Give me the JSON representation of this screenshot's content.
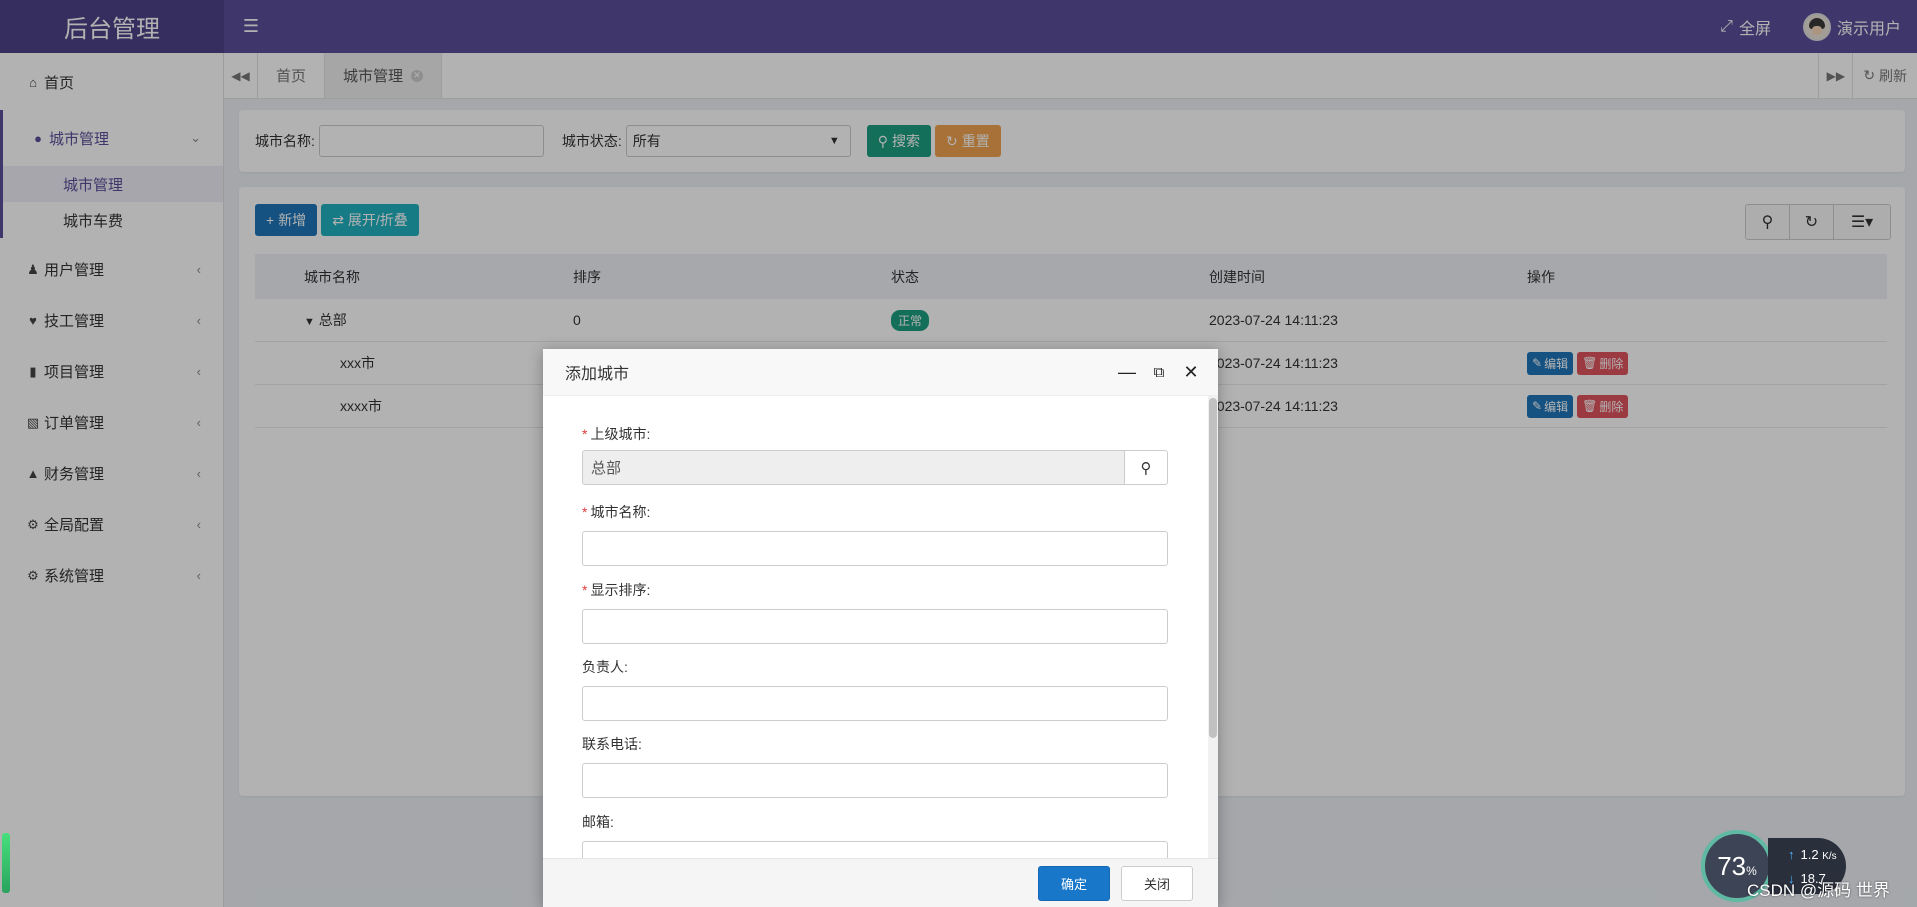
{
  "header": {
    "logo": "后台管理",
    "fullscreen_label": "全屏",
    "user_label": "演示用户"
  },
  "sidebar": {
    "items": [
      {
        "label": "首页",
        "icon": "home-icon"
      },
      {
        "label": "城市管理",
        "icon": "globe-icon",
        "open": true,
        "children": [
          {
            "label": "城市管理",
            "active": true
          },
          {
            "label": "城市车费"
          }
        ]
      },
      {
        "label": "用户管理",
        "icon": "user-icon"
      },
      {
        "label": "技工管理",
        "icon": "heart-icon"
      },
      {
        "label": "项目管理",
        "icon": "bookmark-icon"
      },
      {
        "label": "订单管理",
        "icon": "bar-chart-icon"
      },
      {
        "label": "财务管理",
        "icon": "area-chart-icon"
      },
      {
        "label": "全局配置",
        "icon": "cogs-icon"
      },
      {
        "label": "系统管理",
        "icon": "gear-icon"
      }
    ]
  },
  "tabs": {
    "items": [
      {
        "label": "首页"
      },
      {
        "label": "城市管理",
        "active": true
      }
    ],
    "refresh_label": "刷新"
  },
  "search": {
    "name_label": "城市名称:",
    "name_value": "",
    "status_label": "城市状态:",
    "status_value": "所有",
    "search_btn": "搜索",
    "reset_btn": "重置"
  },
  "toolbar": {
    "add_btn": "新增",
    "expand_btn": "展开/折叠"
  },
  "table": {
    "columns": [
      "城市名称",
      "排序",
      "状态",
      "创建时间",
      "操作"
    ],
    "rows": [
      {
        "name": "总部",
        "sort": "0",
        "status": "正常",
        "created": "2023-07-24 14:11:23",
        "actions": []
      },
      {
        "name": "xxx市",
        "sort": "",
        "status": "",
        "created": "2023-07-24 14:11:23",
        "actions": [
          "编辑",
          "删除"
        ]
      },
      {
        "name": "xxxx市",
        "sort": "",
        "status": "",
        "created": "2023-07-24 14:11:23",
        "actions": [
          "编辑",
          "删除"
        ]
      }
    ]
  },
  "modal": {
    "title": "添加城市",
    "fields": [
      {
        "label": "上级城市:",
        "required": true,
        "value": "总部",
        "readonly": true
      },
      {
        "label": "城市名称:",
        "required": true,
        "value": ""
      },
      {
        "label": "显示排序:",
        "required": true,
        "value": ""
      },
      {
        "label": "负责人:",
        "required": false,
        "value": ""
      },
      {
        "label": "联系电话:",
        "required": false,
        "value": ""
      },
      {
        "label": "邮箱:",
        "required": false,
        "value": ""
      }
    ],
    "ok_btn": "确定",
    "close_btn": "关闭"
  },
  "widget": {
    "cpu_percent": "73",
    "percent_sign": "%",
    "net_up": "1.2",
    "net_up_unit": "K/s",
    "net_down": "18.7",
    "watermark": "CSDN @源码 世界"
  },
  "colors": {
    "header": "#5b4f9a",
    "accent_green": "#1c9f82",
    "accent_orange": "#f0a34f",
    "primary_blue": "#1f76b9"
  }
}
